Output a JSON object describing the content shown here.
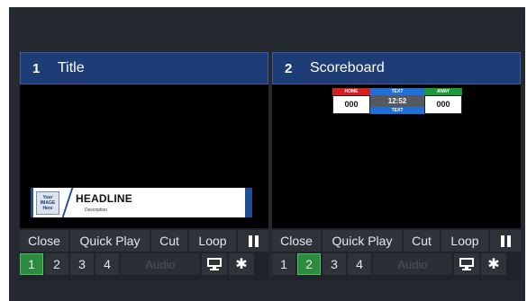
{
  "panels": [
    {
      "number": "1",
      "title": "Title",
      "graphic": {
        "type": "lower-third",
        "logo_lines": [
          "Your",
          "IMAGE",
          "Here"
        ],
        "headline": "HEADLINE",
        "description": "Description"
      },
      "controls": {
        "close": "Close",
        "quick_play": "Quick Play",
        "cut": "Cut",
        "loop": "Loop",
        "pause_icon": "pause-icon"
      },
      "layers": [
        "1",
        "2",
        "3",
        "4"
      ],
      "active_layer": "1",
      "audio": "Audio",
      "output_icon": "monitor-icon",
      "settings_icon": "gear-icon"
    },
    {
      "number": "2",
      "title": "Scoreboard",
      "graphic": {
        "type": "scoreboard",
        "home_label": "HOME",
        "top_text": "TEXT",
        "away_label": "AWAY",
        "home_score": "000",
        "clock": "12:52",
        "away_score": "000",
        "bottom_text": "TEXT"
      },
      "controls": {
        "close": "Close",
        "quick_play": "Quick Play",
        "cut": "Cut",
        "loop": "Loop",
        "pause_icon": "pause-icon"
      },
      "layers": [
        "1",
        "2",
        "3",
        "4"
      ],
      "active_layer": "2",
      "audio": "Audio",
      "output_icon": "monitor-icon",
      "settings_icon": "gear-icon"
    }
  ],
  "colors": {
    "header": "#1e3d77",
    "active_layer": "#2d8a3e",
    "home": "#d81e1e",
    "away": "#1f9a3a",
    "text_bar": "#1e6fd9"
  }
}
